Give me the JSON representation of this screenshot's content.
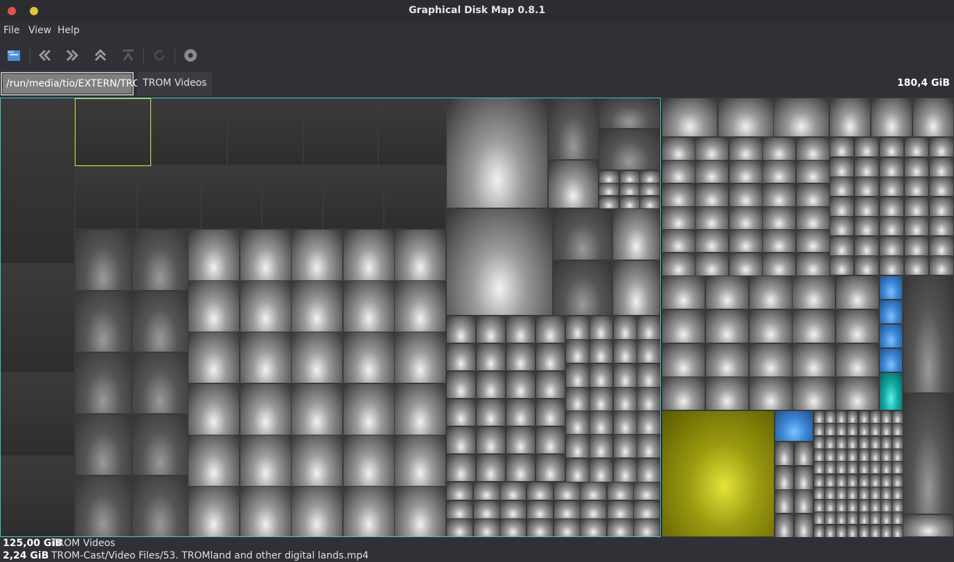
{
  "window": {
    "title": "Graphical Disk Map 0.8.1"
  },
  "menu": {
    "items": [
      "File",
      "View",
      "Help"
    ]
  },
  "toolbar": {
    "icons": [
      "open-icon",
      "back-icon",
      "forward-icon",
      "up-icon",
      "top-icon",
      "refresh-icon",
      "settings-icon"
    ]
  },
  "path": {
    "active": "/run/media/tio/EXTERN/TROM",
    "sub": "TROM Videos",
    "total": "180,4 GiB"
  },
  "status": {
    "row1": {
      "size": "125,00 GiB",
      "name": "TROM Videos"
    },
    "row2": {
      "size": "2,24 GiB",
      "name": "TROM-Cast/Video Files/53. TROMland and other digital lands.mp4"
    }
  },
  "colors": {
    "highlight_cyan": "#3cc9cf",
    "highlight_yellow": "#e6e23a",
    "file_yellow": "#c8c820",
    "file_blue": "#3b86d6",
    "file_teal": "#12a8a4"
  }
}
